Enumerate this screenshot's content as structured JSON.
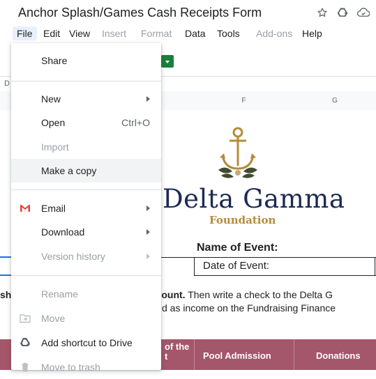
{
  "document": {
    "title": "Anchor Splash/Games Cash Receipts Form"
  },
  "menu_bar": {
    "items": [
      {
        "label": "File",
        "state": "active"
      },
      {
        "label": "Edit",
        "state": "normal"
      },
      {
        "label": "View",
        "state": "normal"
      },
      {
        "label": "Insert",
        "state": "disabled"
      },
      {
        "label": "Format",
        "state": "disabled"
      },
      {
        "label": "Data",
        "state": "normal"
      },
      {
        "label": "Tools",
        "state": "normal"
      },
      {
        "label": "Add-ons",
        "state": "disabled"
      },
      {
        "label": "Help",
        "state": "normal"
      }
    ]
  },
  "formula_bar": {
    "cell_ref_partial": "D"
  },
  "columns": {
    "f": "F",
    "g": "G"
  },
  "sheet": {
    "brand_name": "Delta Gamma",
    "brand_sub": "Foundation",
    "event_name_label": "Name of Event:",
    "event_date_label": "Date of Event:",
    "instr_line1_start": "sh",
    "instr_line1_bold": "ount.",
    "instr_line1_rest": " Then write a check to the Delta G",
    "instr_line2": "d as income on the Fundraising Finance",
    "table_headers": {
      "partial_line1": "of the",
      "partial_line2": "t",
      "pool_admission": "Pool Admission",
      "donations": "Donations"
    }
  },
  "file_menu": {
    "share": "Share",
    "new": "New",
    "open": "Open",
    "open_shortcut": "Ctrl+O",
    "import": "Import",
    "make_copy": "Make a copy",
    "email": "Email",
    "download": "Download",
    "version_history": "Version history",
    "rename": "Rename",
    "move": "Move",
    "add_shortcut": "Add shortcut to Drive",
    "move_to_trash": "Move to trash"
  },
  "colors": {
    "accent_blue": "#1a73e8",
    "sheets_green": "#188038",
    "table_header": "#a4566b",
    "brand_navy": "#1b2a52",
    "brand_gold": "#b58b3a",
    "gmail_red": "#ea4335"
  }
}
